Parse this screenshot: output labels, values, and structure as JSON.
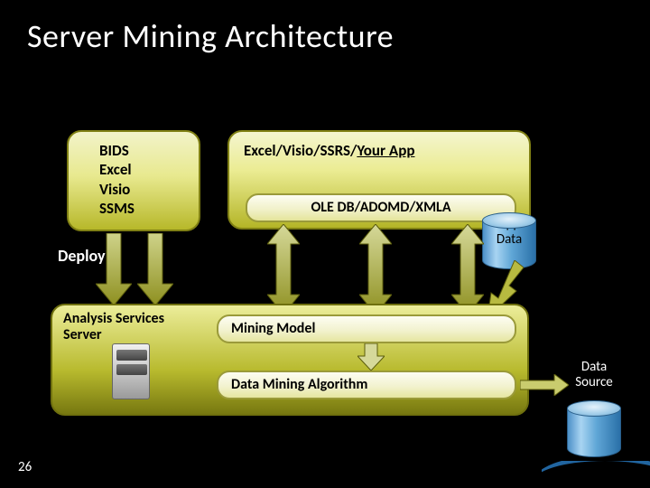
{
  "title": "Server Mining Architecture",
  "slide_number": "26",
  "tools_box": {
    "lines": [
      "BIDS",
      "Excel",
      "Visio",
      "SSMS"
    ]
  },
  "apps_box": {
    "prefix": "Excel/Visio/SSRS/",
    "underlined": "Your App"
  },
  "oledb_bar": "OLE DB/ADOMD/XMLA",
  "deploy_label": "Deploy",
  "server_box": {
    "line1": "Analysis Services",
    "line2": "Server"
  },
  "mining_model_bar": "Mining Model",
  "algorithm_bar": "Data Mining Algorithm",
  "app_data_label_l1": "App",
  "app_data_label_l2": "Data",
  "data_source_label_l1": "Data",
  "data_source_label_l2": "Source",
  "colors": {
    "olive_dark": "#808014",
    "olive_light": "#ebec93",
    "cyl_blue": "#5fa6d6"
  }
}
